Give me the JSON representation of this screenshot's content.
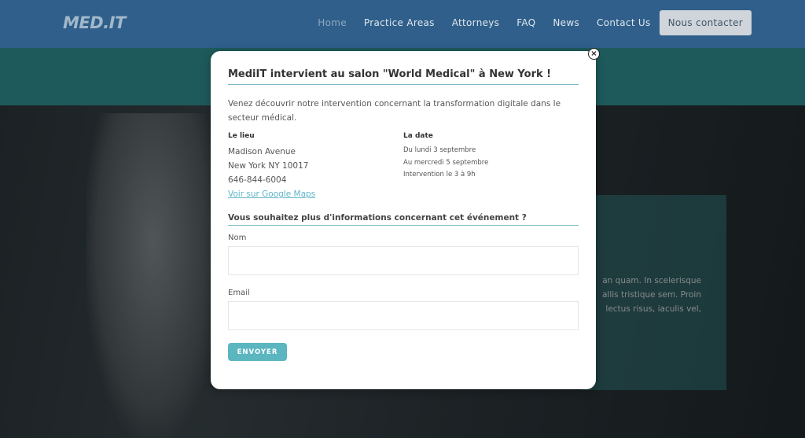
{
  "header": {
    "logo": "MED.IT",
    "nav": [
      "Home",
      "Practice Areas",
      "Attorneys",
      "FAQ",
      "News",
      "Contact Us"
    ],
    "cta": "Nous contacter"
  },
  "hero": {
    "text_lines": [
      "an quam. In scelerisque",
      "allis tristique sem. Proin",
      "lectus risus, iaculis vel,"
    ]
  },
  "modal": {
    "close_icon": "×",
    "title": "MediIT intervient au salon \"World Medical\" à New York !",
    "intro": "Venez découvrir notre intervention concernant la transformation digitale dans le secteur médical.",
    "lieu": {
      "label": "Le lieu",
      "line1": "Madison Avenue",
      "line2": "New York NY 10017",
      "line3": "646-844-6004",
      "link": "Voir sur Google Maps"
    },
    "date": {
      "label": "La date",
      "line1": "Du lundi 3 septembre",
      "line2": "Au mercredi 5 septembre",
      "line3": "Intervention le 3 à 9h"
    },
    "form_title": "Vous souhaitez plus d'informations concernant cet événement ?",
    "name_label": "Nom",
    "name_value": "",
    "email_label": "Email",
    "email_value": "",
    "submit": "ENVOYER"
  },
  "colors": {
    "header_bg": "#2f5f8a",
    "teal_band": "#2f8a8c",
    "accent": "#5bb6c0"
  }
}
